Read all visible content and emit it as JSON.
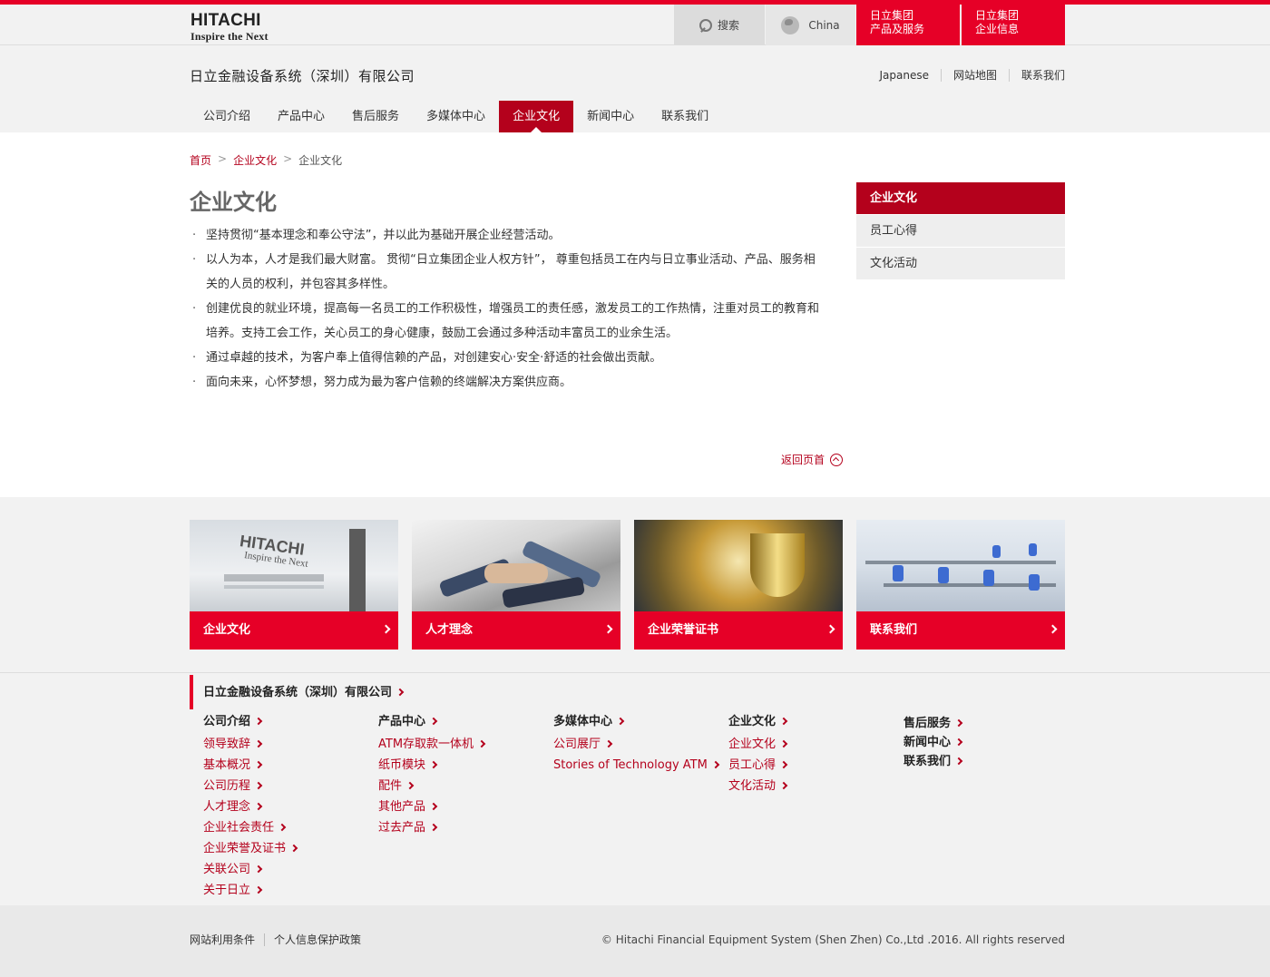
{
  "header": {
    "logo_line1": "HITACHI",
    "logo_line2": "Inspire the Next",
    "search_label": "搜索",
    "region_label": "China",
    "red_btn1_line1": "日立集团",
    "red_btn1_line2": "产品及服务",
    "red_btn2_line1": "日立集团",
    "red_btn2_line2": "企业信息",
    "company_name": "日立金融设备系统（深圳）有限公司",
    "util_links": [
      "Japanese",
      "网站地图",
      "联系我们"
    ]
  },
  "nav": {
    "items": [
      "公司介绍",
      "产品中心",
      "售后服务",
      "多媒体中心",
      "企业文化",
      "新闻中心",
      "联系我们"
    ],
    "active_index": 4
  },
  "breadcrumb": [
    "首页",
    ">",
    "企业文化",
    ">",
    "企业文化"
  ],
  "page_title": "企业文化",
  "bullets": [
    "坚持贯彻“基本理念和奉公守法”，并以此为基础开展企业经营活动。",
    "以人为本，人才是我们最大财富。 贯彻“日立集团企业人权方针”， 尊重包括员工在内与日立事业活动、产品、服务相关的人员的权利，并包容其多样性。",
    "创建优良的就业环境，提高每一名员工的工作积极性，增强员工的责任感，激发员工的工作热情，注重对员工的教育和培养。支持工会工作，关心员工的身心健康，鼓励工会通过多种活动丰富员工的业余生活。",
    "通过卓越的技术，为客户奉上值得信赖的产品，对创建安心·安全·舒适的社会做出贡献。",
    "面向未来，心怀梦想，努力成为最为客户信赖的终端解决方案供应商。"
  ],
  "back_to_top": "返回页首",
  "sidenav": [
    "企业文化",
    "员工心得",
    "文化活动"
  ],
  "cards": [
    "企业文化",
    "人才理念",
    "企业荣誉证书",
    "联系我们"
  ],
  "card1_img_text1": "HITACHI",
  "card1_img_text2": "Inspire the Next",
  "footer": {
    "title": "日立金融设备系统（深圳）有限公司",
    "col1": {
      "heading": "公司介绍",
      "links": [
        "领导致辞",
        "基本概况",
        "公司历程",
        "人才理念",
        "企业社会责任",
        "企业荣誉及证书",
        "关联公司",
        "关于日立"
      ]
    },
    "col2": {
      "heading": "产品中心",
      "links": [
        "ATM存取款一体机",
        "纸币模块",
        "配件",
        "其他产品",
        "过去产品"
      ]
    },
    "col3": {
      "heading": "多媒体中心",
      "links": [
        "公司展厅",
        "Stories of Technology ATM"
      ]
    },
    "col4": {
      "heading": "企业文化",
      "links": [
        "企业文化",
        "员工心得",
        "文化活动"
      ]
    },
    "col5": {
      "headings": [
        "售后服务",
        "新闻中心",
        "联系我们"
      ]
    },
    "bottom_links": [
      "网站利用条件",
      "个人信息保护政策"
    ],
    "copyright": "© Hitachi Financial Equipment System (Shen Zhen) Co.,Ltd .2016. All rights reserved"
  }
}
